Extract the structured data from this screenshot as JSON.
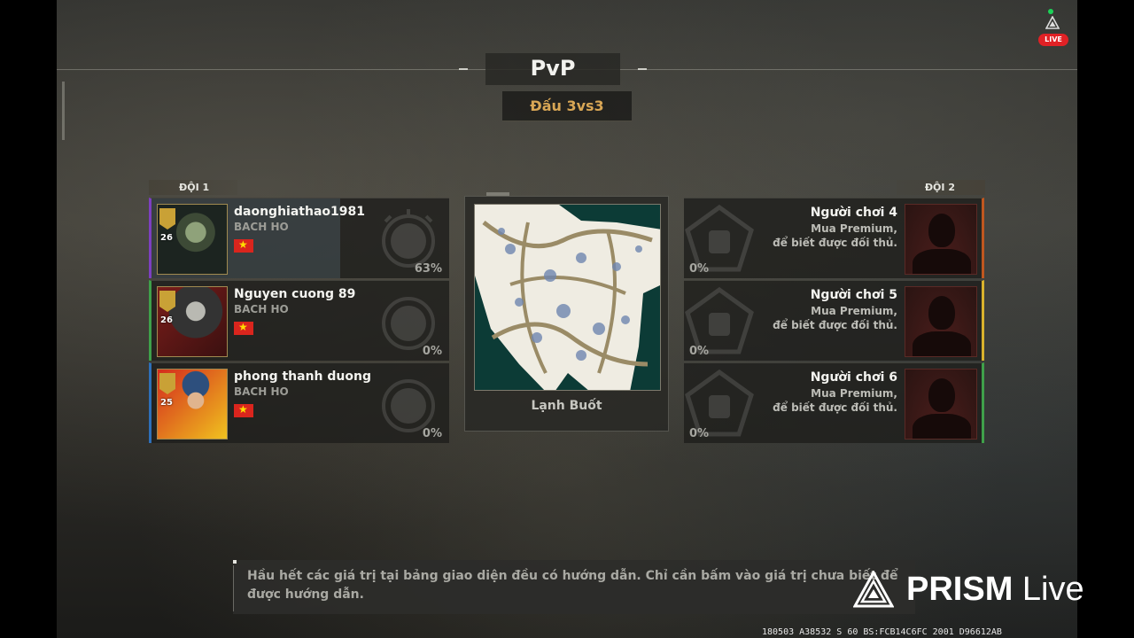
{
  "header": {
    "title": "PvP",
    "mode": "Đấu 3vs3"
  },
  "teams": {
    "left_label": "ĐỘI 1",
    "right_label": "ĐỘI 2"
  },
  "team1": [
    {
      "name": "daonghiathao1981",
      "clan": "BACH HO",
      "rank": "26",
      "progress": "63%",
      "accent": "#7d3fc0"
    },
    {
      "name": "Nguyen cuong 89",
      "clan": "BACH HO",
      "rank": "26",
      "progress": "0%",
      "accent": "#3fa04a"
    },
    {
      "name": "phong thanh duong",
      "clan": "BACH HO",
      "rank": "25",
      "progress": "0%",
      "accent": "#2e6fb8"
    }
  ],
  "team2": [
    {
      "name": "Người chơi 4",
      "premium_line1": "Mua Premium,",
      "premium_line2": "để biết được đối thủ.",
      "progress": "0%",
      "accent": "#c0571f"
    },
    {
      "name": "Người chơi 5",
      "premium_line1": "Mua Premium,",
      "premium_line2": "để biết được đối thủ.",
      "progress": "0%",
      "accent": "#d9b22c"
    },
    {
      "name": "Người chơi 6",
      "premium_line1": "Mua Premium,",
      "premium_line2": "để biết được đối thủ.",
      "progress": "0%",
      "accent": "#3fa04a"
    }
  ],
  "map": {
    "name": "Lạnh Buốt"
  },
  "hint": {
    "text": "Hầu hết các giá trị tại bảng giao diện đều có hướng dẫn. Chỉ cần bấm vào giá trị chưa biết để được hướng dẫn."
  },
  "overlay": {
    "live_label": "LIVE",
    "brand_bold": "PRISM",
    "brand_light": "Live",
    "debug_text": "180503 A38532 S 60 BS:FCB14C6FC 2001 D96612AB"
  }
}
